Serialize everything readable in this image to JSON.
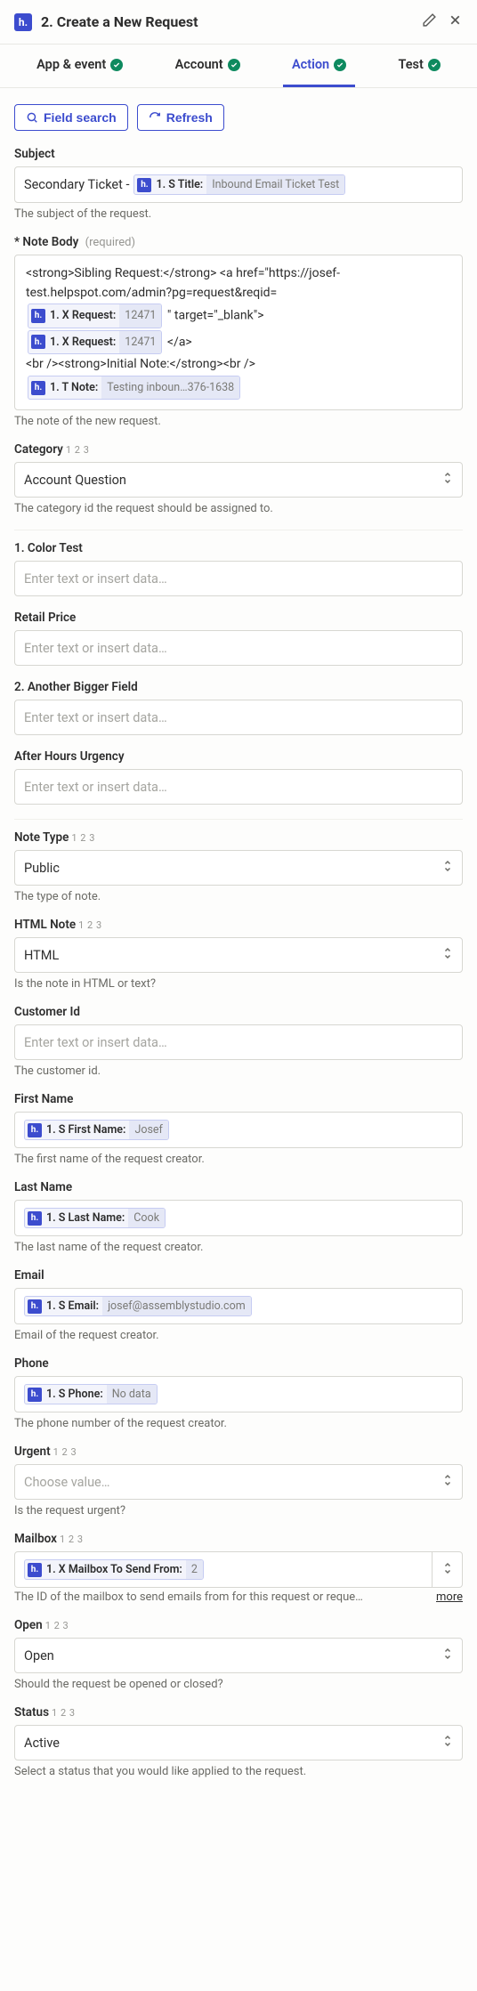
{
  "header": {
    "app_icon_letter": "h.",
    "title": "2. Create a New Request"
  },
  "tabs": [
    {
      "label": "App & event",
      "active": false
    },
    {
      "label": "Account",
      "active": false
    },
    {
      "label": "Action",
      "active": true
    },
    {
      "label": "Test",
      "active": false
    }
  ],
  "toolbar": {
    "field_search": "Field search",
    "refresh": "Refresh"
  },
  "pill_icon_letter": "h.",
  "fields": {
    "subject": {
      "label": "Subject",
      "prefix_text": "Secondary Ticket - ",
      "pill": {
        "key": "1. S Title:",
        "value": "Inbound Email Ticket Test"
      },
      "help": "The subject of the request."
    },
    "note_body": {
      "label": "Note Body",
      "req_marker": "*",
      "req_text": "(required)",
      "line1_a": "<strong>Sibling Request:</strong> <a href=\"https://josef-test.helpspot.com/admin?pg=request&reqid=",
      "pill1": {
        "key": "1. X Request:",
        "value": "12471"
      },
      "line1_b": "\" target=\"_blank\">",
      "pill2": {
        "key": "1. X Request:",
        "value": "12471"
      },
      "line2_b": "</a>",
      "line3": "<br /><strong>Initial Note:</strong><br />",
      "pill3": {
        "key": "1. T Note:",
        "value": "Testing inboun…376-1638"
      },
      "help": "The note of the new request."
    },
    "category": {
      "label": "Category",
      "hint": "1 2 3",
      "value": "Account Question",
      "help": "The category id the request should be assigned to."
    },
    "color_test": {
      "label": "1. Color Test",
      "placeholder": "Enter text or insert data…"
    },
    "retail_price": {
      "label": "Retail Price",
      "placeholder": "Enter text or insert data…"
    },
    "bigger_field": {
      "label": "2. Another Bigger Field",
      "placeholder": "Enter text or insert data…"
    },
    "after_hours": {
      "label": "After Hours Urgency",
      "placeholder": "Enter text or insert data…"
    },
    "note_type": {
      "label": "Note Type",
      "hint": "1 2 3",
      "value": "Public",
      "help": "The type of note."
    },
    "html_note": {
      "label": "HTML Note",
      "hint": "1 2 3",
      "value": "HTML",
      "help": "Is the note in HTML or text?"
    },
    "customer_id": {
      "label": "Customer Id",
      "placeholder": "Enter text or insert data…",
      "help": "The customer id."
    },
    "first_name": {
      "label": "First Name",
      "pill": {
        "key": "1. S First Name:",
        "value": "Josef"
      },
      "help": "The first name of the request creator."
    },
    "last_name": {
      "label": "Last Name",
      "pill": {
        "key": "1. S Last Name:",
        "value": "Cook"
      },
      "help": "The last name of the request creator."
    },
    "email": {
      "label": "Email",
      "pill": {
        "key": "1. S Email:",
        "value": "josef@assemblystudio.com"
      },
      "help": "Email of the request creator."
    },
    "phone": {
      "label": "Phone",
      "pill": {
        "key": "1. S Phone:",
        "value": "No data"
      },
      "help": "The phone number of the request creator."
    },
    "urgent": {
      "label": "Urgent",
      "hint": "1 2 3",
      "placeholder": "Choose value…",
      "help": "Is the request urgent?"
    },
    "mailbox": {
      "label": "Mailbox",
      "hint": "1 2 3",
      "pill": {
        "key": "1. X Mailbox To Send From:",
        "value": "2"
      },
      "help": "The ID of the mailbox to send emails from for this request or reque…",
      "more": "more"
    },
    "open": {
      "label": "Open",
      "hint": "1 2 3",
      "value": "Open",
      "help": "Should the request be opened or closed?"
    },
    "status": {
      "label": "Status",
      "hint": "1 2 3",
      "value": "Active",
      "help": "Select a status that you would like applied to the request."
    }
  }
}
